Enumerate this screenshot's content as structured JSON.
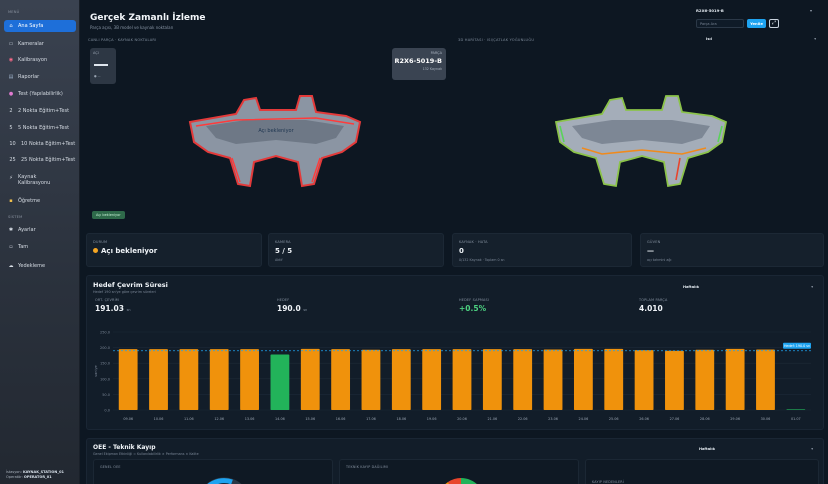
{
  "sidebar": {
    "section_main": "MENÜ",
    "section_system": "SİSTEM",
    "items": [
      {
        "label": "Ana Sayfa",
        "icon": "home-icon"
      },
      {
        "label": "Kameralar",
        "icon": "camera-icon"
      },
      {
        "label": "Kalibrasyon",
        "icon": "target-icon"
      },
      {
        "label": "Raporlar",
        "icon": "chart-icon"
      },
      {
        "label": "Test (Yapılabilirlik)",
        "icon": "flask-icon"
      },
      {
        "label": "2 Nokta Eğitim+Test",
        "icon": "number-2-icon"
      },
      {
        "label": "5 Nokta Eğitim+Test",
        "icon": "number-5-icon"
      },
      {
        "label": "10 Nokta Eğitim+Test",
        "icon": "number-10-icon"
      },
      {
        "label": "25 Nokta Eğitim+Test",
        "icon": "number-25-icon"
      },
      {
        "label": "Kaynak Kalibrasyonu",
        "icon": "weld-icon"
      },
      {
        "label": "Öğretme",
        "icon": "teach-icon"
      }
    ],
    "system_items": [
      {
        "label": "Ayarlar",
        "icon": "gear-icon"
      },
      {
        "label": "Tam",
        "icon": "fullscreen-icon"
      },
      {
        "label": "Yedekleme",
        "icon": "cloud-icon"
      }
    ],
    "footer": {
      "station_label": "İstasyon:",
      "station_value": "KAYNAK_STATION_01",
      "operator_label": "Operatör:",
      "operator_value": "OPERATOR_01"
    }
  },
  "header": {
    "title": "Gerçek Zamanlı İzleme",
    "subtitle": "Parça açısı, 3B model ve kaynak noktaları"
  },
  "topright": {
    "select_value": "R2X6-5019-B",
    "search_placeholder": "Parça Ara",
    "search_button": "Yenile",
    "icon_button": "⤢"
  },
  "viewer": {
    "left_label": "CANLI PARÇA · KAYNAK NOKTALARI",
    "right_label": "3D HARİTASI · ISI/ÇATLAK YOĞUNLUĞU",
    "camera_chip_label": "AÇI",
    "camera_chip_dot": "●  —",
    "part_chip_key": "PARÇA",
    "part_chip_value": "R2X6-5019-B",
    "part_chip_sub": "132 Kaynak",
    "right_select": "Isıl",
    "badge": "Açı bekleniyor",
    "part_overlay_text": "Açı bekleniyor"
  },
  "status_cards": [
    {
      "key": "DURUM",
      "value": "Açı bekleniyor",
      "sub": "",
      "dot": true
    },
    {
      "key": "KAMERA",
      "value": "5 / 5",
      "sub": "Aktif",
      "dot": false
    },
    {
      "key": "KAYNAK · HATA",
      "value": "0",
      "sub": "0/132 Kaynak · Toplam 0 sn",
      "dot": false
    },
    {
      "key": "GÜVEN",
      "value": "—",
      "sub": "açı tahmini ağı",
      "dot": false
    }
  ],
  "cycle": {
    "title": "Hedef Çevrim Süresi",
    "subtitle": "Hedef 190 sn'ye göre çevrim süreleri",
    "select": "Haftalık",
    "kpis": [
      {
        "key": "ORT. ÇEVRİM",
        "value": "191.03",
        "unit": "sn",
        "green": false
      },
      {
        "key": "HEDEF",
        "value": "190.0",
        "unit": "sn",
        "green": false
      },
      {
        "key": "HEDEF SAPMASI",
        "value": "+0.5%",
        "unit": "",
        "green": true
      },
      {
        "key": "TOPLAM PARÇA",
        "value": "4.010",
        "unit": "",
        "green": false
      }
    ],
    "target_label": "Hedef: 190.0 sn",
    "colors": {
      "over": "#f0920c",
      "under": "#22b35a",
      "target": "#1ea3f0"
    }
  },
  "chart_data": {
    "type": "bar",
    "title": "Hedef Çevrim Süresi",
    "xlabel": "",
    "ylabel": "saniye",
    "ylim": [
      0,
      250
    ],
    "yticks": [
      "0.0",
      "50.0",
      "100.0",
      "150.0",
      "200.0",
      "250.0"
    ],
    "target": 190,
    "categories": [
      "09.06",
      "10.06",
      "11.06",
      "12.06",
      "13.06",
      "14.06",
      "15.06",
      "16.06",
      "17.06",
      "18.06",
      "19.06",
      "20.06",
      "21.06",
      "22.06",
      "23.06",
      "24.06",
      "25.06",
      "26.06",
      "27.06",
      "28.06",
      "29.06",
      "30.06",
      "01.07"
    ],
    "values": [
      195,
      195,
      195,
      195,
      195,
      178,
      196,
      195,
      193,
      195,
      195,
      195,
      195,
      195,
      194,
      196,
      196,
      192,
      190,
      193,
      196,
      194,
      2
    ]
  },
  "oee": {
    "title": "OEE - Teknik Kayıp",
    "subtitle": "Genel Ekipman Etkinliği = Kullanılabilirlik × Performans × Kalite",
    "select": "Haftalık",
    "card1_label": "GENEL OEE",
    "card2_label": "TEKNİK KAYIP DAĞILIMI",
    "card3_label": "KAYIP NEDENLERİ"
  }
}
